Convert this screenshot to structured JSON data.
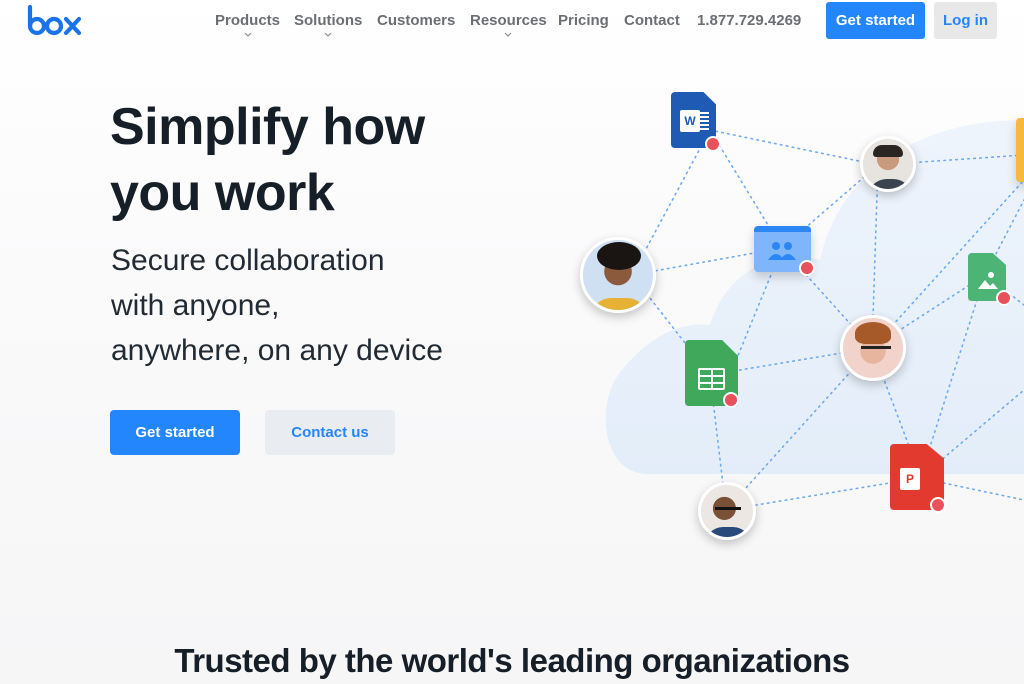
{
  "brand": {
    "logo_text": "box",
    "accent": "#2486fc"
  },
  "nav": {
    "items": [
      {
        "label": "Products",
        "has_dropdown": true
      },
      {
        "label": "Solutions",
        "has_dropdown": true
      },
      {
        "label": "Customers",
        "has_dropdown": false
      },
      {
        "label": "Resources",
        "has_dropdown": true
      },
      {
        "label": "Pricing",
        "has_dropdown": false
      },
      {
        "label": "Contact",
        "has_dropdown": false
      }
    ],
    "phone": "1.877.729.4269",
    "get_started_label": "Get started",
    "login_label": "Log in"
  },
  "hero": {
    "title_line1": "Simplify how",
    "title_line2": "you work",
    "subtitle_line1": "Secure collaboration",
    "subtitle_line2": "with anyone,",
    "subtitle_line3": "anywhere, on any device",
    "primary_cta": "Get started",
    "secondary_cta": "Contact us"
  },
  "illustration": {
    "files": [
      {
        "type": "word",
        "letter": "W",
        "color": "#1f5bb5",
        "locked": true
      },
      {
        "type": "shared-folder",
        "color": "#7fb6fb",
        "locked": true
      },
      {
        "type": "spreadsheet",
        "color": "#3fa85b",
        "locked": true
      },
      {
        "type": "image",
        "color": "#4cb576",
        "locked": true
      },
      {
        "type": "powerpoint",
        "letter": "P",
        "color": "#e33a2f",
        "locked": true
      },
      {
        "type": "note",
        "color": "#f6b93b",
        "locked": false
      }
    ],
    "people_count": 4
  },
  "trusted_heading": "Trusted by the world's leading organizations"
}
